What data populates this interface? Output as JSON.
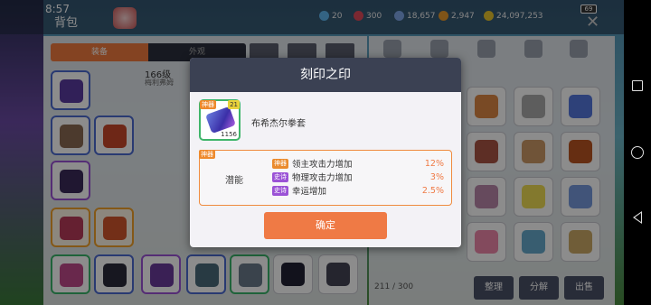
{
  "status": {
    "time": "8:57",
    "battery": "69"
  },
  "header": {
    "title": "背包",
    "currencies": [
      "20",
      "300",
      "18,657",
      "2,947",
      "24,097,253"
    ]
  },
  "inventory": {
    "tabs": [
      "装备",
      "外观"
    ],
    "level_text": "166级",
    "owner": "梅利弗姆",
    "capacity": "211 / 300",
    "buttons": [
      "整理",
      "分解",
      "出售"
    ]
  },
  "dialog": {
    "title": "刻印之印",
    "item": {
      "grade_tag": "神器",
      "level_tag": "21",
      "count": "1156",
      "name": "布希杰尔拳套"
    },
    "potential": {
      "grade_tag": "神器",
      "label": "潜能",
      "lines": [
        {
          "rank": "神器",
          "stat": "领主攻击力增加",
          "value": "12%",
          "color": "#ef7a45"
        },
        {
          "rank": "史诗",
          "stat": "物理攻击力增加",
          "value": "3%",
          "color": "#ef7a45"
        },
        {
          "rank": "史诗",
          "stat": "幸运增加",
          "value": "2.5%",
          "color": "#ef7a45"
        }
      ]
    },
    "confirm_label": "确定"
  },
  "nav": {
    "recent": "recent-apps-icon",
    "home": "home-icon",
    "back": "back-icon"
  }
}
